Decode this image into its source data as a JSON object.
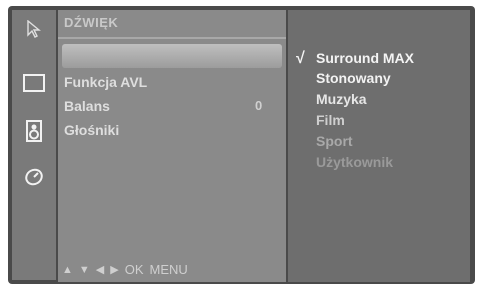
{
  "menu": {
    "title": "DŹWIĘK",
    "items": [
      {
        "label": "Funkcja AVL",
        "value": ""
      },
      {
        "label": "Balans",
        "value": "0"
      },
      {
        "label": "Głośniki",
        "value": ""
      }
    ],
    "footer": {
      "ok": "OK",
      "menu": "MENU"
    }
  },
  "icons": [
    "cursor-icon",
    "picture-icon",
    "speaker-icon",
    "clock-icon"
  ],
  "submenu": {
    "items": [
      {
        "label": "Surround MAX",
        "selected": true,
        "color": "#f4f4f4"
      },
      {
        "label": "Stonowany",
        "color": "#f2f2f2"
      },
      {
        "label": "Muzyka",
        "color": "#e6e6e6"
      },
      {
        "label": "Film",
        "color": "#cfcfcf"
      },
      {
        "label": "Sport",
        "color": "#a9a9a9"
      },
      {
        "label": "Użytkownik",
        "color": "#9a9a9a"
      }
    ]
  }
}
